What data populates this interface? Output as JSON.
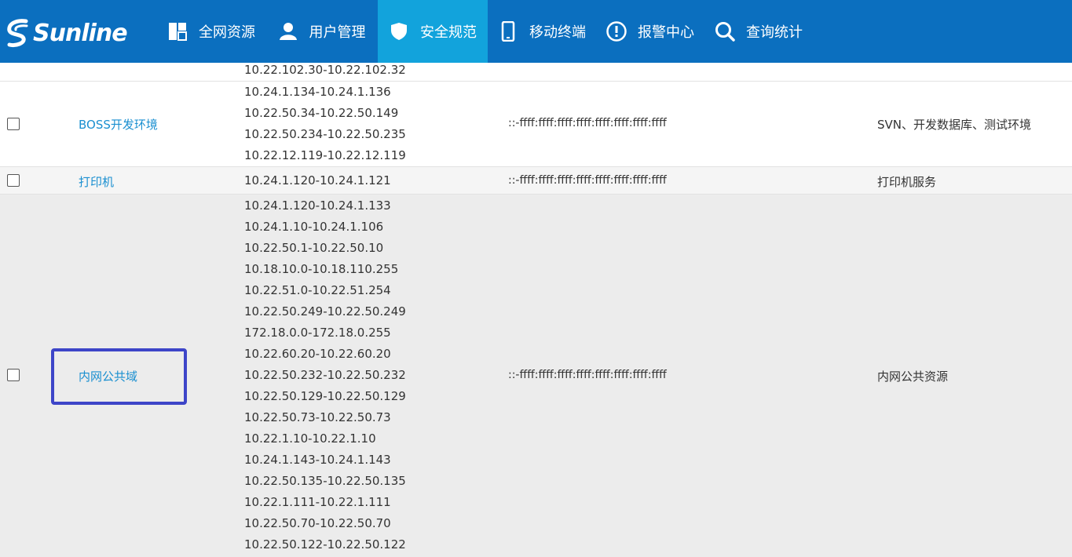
{
  "brand": {
    "name": "Sunline"
  },
  "nav": [
    {
      "label": "全网资源",
      "icon": "grid-icon"
    },
    {
      "label": "用户管理",
      "icon": "user-icon"
    },
    {
      "label": "安全规范",
      "icon": "shield-icon",
      "active": true
    },
    {
      "label": "移动终端",
      "icon": "mobile-icon"
    },
    {
      "label": "报警中心",
      "icon": "alert-icon"
    },
    {
      "label": "查询统计",
      "icon": "search-icon"
    }
  ],
  "rows": [
    {
      "ipv4": [
        "10.22.102.30-10.22.102.32"
      ]
    },
    {
      "name": "BOSS开发环境",
      "ipv4": [
        "10.24.1.134-10.24.1.136",
        "10.22.50.34-10.22.50.149",
        "10.22.50.234-10.22.50.235",
        "10.22.12.119-10.22.12.119"
      ],
      "ipv6": "::-ffff:ffff:ffff:ffff:ffff:ffff:ffff:ffff",
      "desc": "SVN、开发数据库、测试环境"
    },
    {
      "name": "打印机",
      "ipv4": [
        "10.24.1.120-10.24.1.121"
      ],
      "ipv6": "::-ffff:ffff:ffff:ffff:ffff:ffff:ffff:ffff",
      "desc": "打印机服务"
    },
    {
      "name": "内网公共域",
      "ipv4": [
        "10.24.1.120-10.24.1.133",
        "10.24.1.10-10.24.1.106",
        "10.22.50.1-10.22.50.10",
        "10.18.10.0-10.18.110.255",
        "10.22.51.0-10.22.51.254",
        "10.22.50.249-10.22.50.249",
        "172.18.0.0-172.18.0.255",
        "10.22.60.20-10.22.60.20",
        "10.22.50.232-10.22.50.232",
        "10.22.50.129-10.22.50.129",
        "10.22.50.73-10.22.50.73",
        "10.22.1.10-10.22.1.10",
        "10.24.1.143-10.24.1.143",
        "10.22.50.135-10.22.50.135",
        "10.22.1.111-10.22.1.111",
        "10.22.50.70-10.22.50.70",
        "10.22.50.122-10.22.50.122"
      ],
      "ipv6": "::-ffff:ffff:ffff:ffff:ffff:ffff:ffff:ffff",
      "desc": "内网公共资源"
    }
  ],
  "colors": {
    "header": "#0b6fbf",
    "active_tab": "#12a3dc",
    "link": "#1a8fd0",
    "highlight_box": "#3d45c8"
  }
}
